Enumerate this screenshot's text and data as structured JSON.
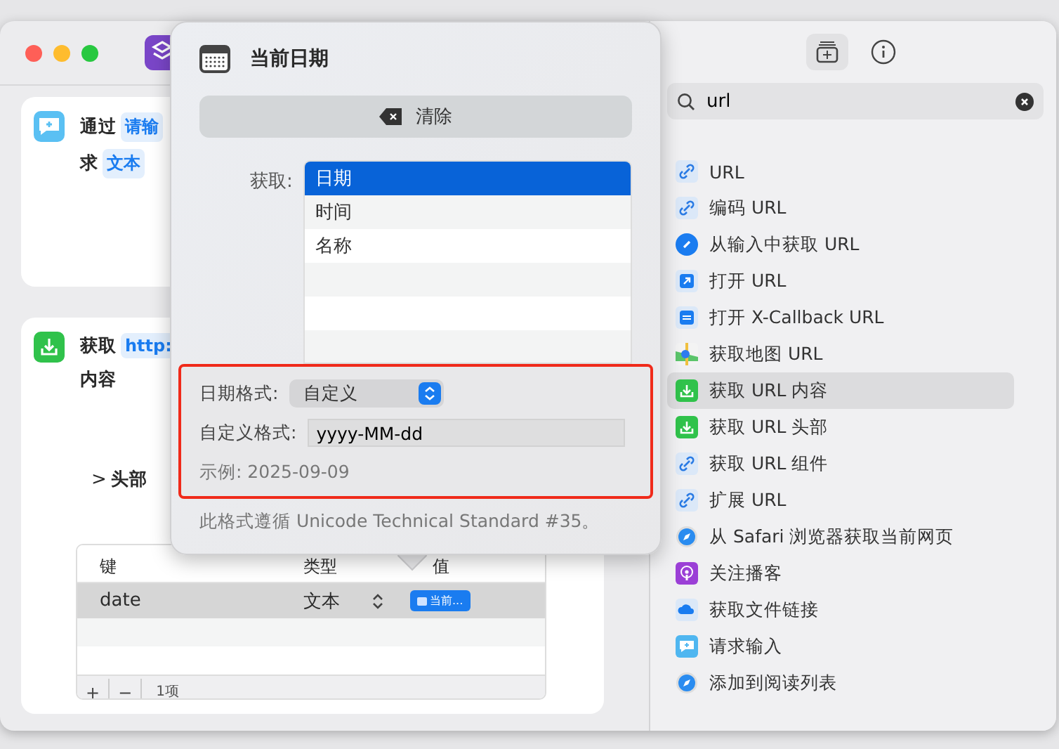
{
  "workflow": {
    "cards": [
      {
        "kind": "message",
        "lines": [
          [
            {
              "kind": "text",
              "text": "通过"
            },
            {
              "kind": "token",
              "text": "请输"
            }
          ],
          [
            {
              "kind": "text",
              "text": "求"
            },
            {
              "kind": "token",
              "text": "文本"
            }
          ]
        ]
      },
      {
        "kind": "download",
        "lines": [
          [
            {
              "kind": "text",
              "text": "获取"
            },
            {
              "kind": "token",
              "text": "http:"
            }
          ],
          [
            {
              "kind": "text",
              "text": "内容"
            }
          ]
        ],
        "disclosure": {
          "chevron": ">",
          "label": "头部"
        },
        "table": {
          "columns": [
            "键",
            "类型",
            "值"
          ],
          "rows": [
            {
              "key": "date",
              "type": "文本",
              "value": "当前...",
              "selected": true
            }
          ],
          "footer": {
            "add": "+",
            "remove": "−",
            "count": "1项"
          }
        }
      }
    ]
  },
  "popover": {
    "title": "当前日期",
    "clear_button": "清除",
    "get_label": "获取:",
    "options": [
      {
        "label": "日期",
        "selected": true
      },
      {
        "label": "时间",
        "selected": false
      },
      {
        "label": "名称",
        "selected": false
      }
    ],
    "highlight": {
      "format_label": "日期格式:",
      "format_value": "自定义",
      "custom_label": "自定义格式:",
      "custom_value": "yyyy-MM-dd",
      "example": "示例: 2025-09-09"
    },
    "note": "此格式遵循 Unicode Technical Standard #35。"
  },
  "sidebar": {
    "tabs": [
      {
        "kind": "library",
        "selected": true
      },
      {
        "kind": "info",
        "selected": false
      }
    ],
    "search": {
      "value": "url"
    },
    "items": [
      {
        "label": "URL",
        "kind": "link",
        "selected": false
      },
      {
        "label": "编码 URL",
        "kind": "link",
        "selected": false
      },
      {
        "label": "从输入中获取 URL",
        "kind": "link-solid",
        "selected": false
      },
      {
        "label": "打开 URL",
        "kind": "open",
        "selected": false
      },
      {
        "label": "打开 X-Callback URL",
        "kind": "callback",
        "selected": false
      },
      {
        "label": "获取地图 URL",
        "kind": "maps",
        "selected": false
      },
      {
        "label": "获取 URL 内容",
        "kind": "download",
        "selected": true
      },
      {
        "label": "获取 URL 头部",
        "kind": "download",
        "selected": false
      },
      {
        "label": "获取 URL 组件",
        "kind": "link",
        "selected": false
      },
      {
        "label": "扩展 URL",
        "kind": "link",
        "selected": false
      },
      {
        "label": "从 Safari 浏览器获取当前网页",
        "kind": "safari",
        "selected": false
      },
      {
        "label": "关注播客",
        "kind": "podcast",
        "selected": false
      },
      {
        "label": "获取文件链接",
        "kind": "cloud",
        "selected": false
      },
      {
        "label": "请求输入",
        "kind": "message",
        "selected": false
      },
      {
        "label": "添加到阅读列表",
        "kind": "safari",
        "selected": false
      }
    ]
  }
}
